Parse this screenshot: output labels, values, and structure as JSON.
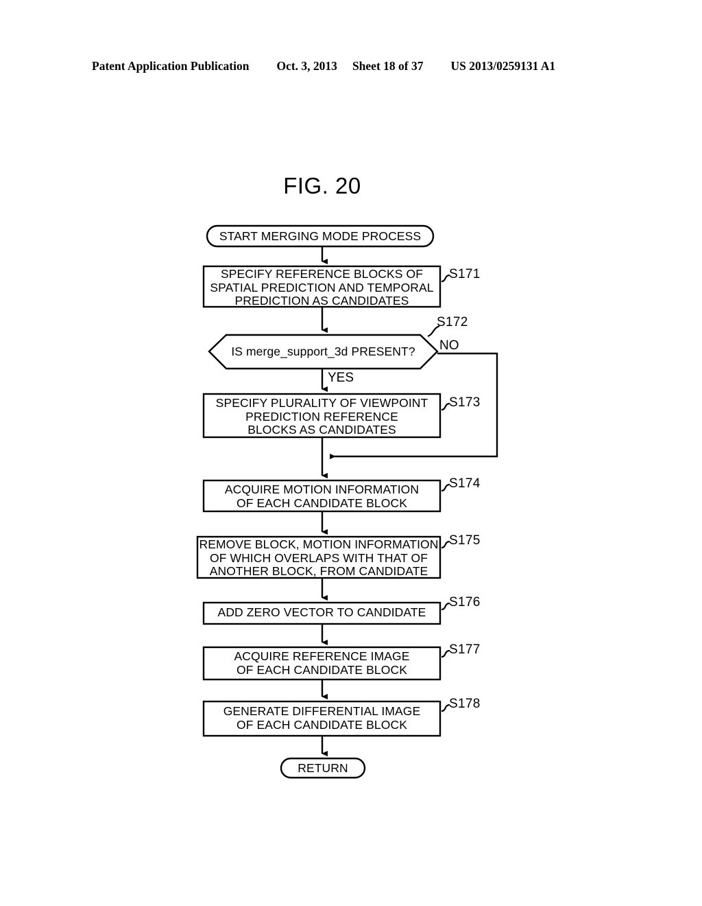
{
  "header": {
    "publication": "Patent Application Publication",
    "date": "Oct. 3, 2013",
    "sheet": "Sheet 18 of 37",
    "number": "US 2013/0259131 A1"
  },
  "figure": {
    "title": "FIG. 20"
  },
  "flowchart": {
    "start": {
      "label": "START MERGING MODE PROCESS"
    },
    "end": {
      "label": "RETURN"
    },
    "branches": {
      "yes": "YES",
      "no": "NO"
    },
    "steps": [
      {
        "id": "S171",
        "text": "SPECIFY REFERENCE BLOCKS OF\nSPATIAL PREDICTION AND TEMPORAL\nPREDICTION AS CANDIDATES",
        "shape": "process"
      },
      {
        "id": "S172",
        "text": "IS merge_support_3d PRESENT?",
        "shape": "decision"
      },
      {
        "id": "S173",
        "text": "SPECIFY PLURALITY OF VIEWPOINT\nPREDICTION REFERENCE\nBLOCKS AS CANDIDATES",
        "shape": "process"
      },
      {
        "id": "S174",
        "text": "ACQUIRE MOTION INFORMATION\nOF EACH CANDIDATE BLOCK",
        "shape": "process"
      },
      {
        "id": "S175",
        "text": "REMOVE BLOCK, MOTION INFORMATION\nOF WHICH OVERLAPS WITH THAT OF\nANOTHER BLOCK, FROM CANDIDATE",
        "shape": "process"
      },
      {
        "id": "S176",
        "text": "ADD ZERO VECTOR TO CANDIDATE",
        "shape": "process"
      },
      {
        "id": "S177",
        "text": "ACQUIRE REFERENCE IMAGE\nOF EACH CANDIDATE BLOCK",
        "shape": "process"
      },
      {
        "id": "S178",
        "text": "GENERATE DIFFERENTIAL IMAGE\nOF EACH CANDIDATE BLOCK",
        "shape": "process"
      }
    ]
  },
  "colors": {
    "ink": "#000000",
    "paper": "#ffffff"
  }
}
